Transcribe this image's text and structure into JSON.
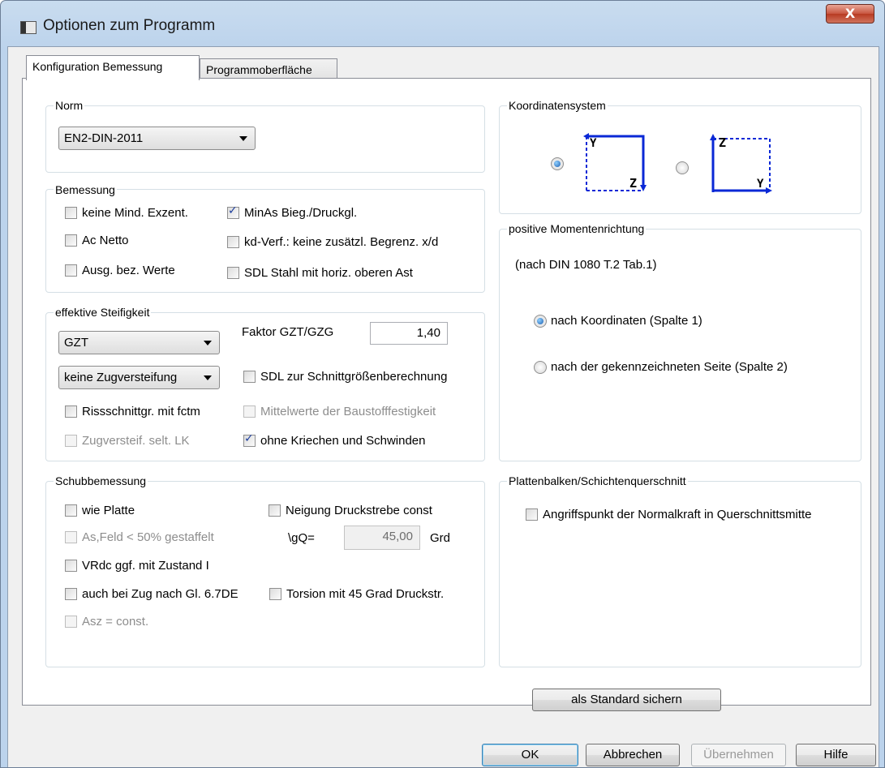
{
  "window": {
    "title": "Optionen zum Programm",
    "close_label": "X"
  },
  "tabs": [
    {
      "label": "Konfiguration Bemessung"
    },
    {
      "label": "Programmoberfläche"
    }
  ],
  "norm": {
    "title": "Norm",
    "selected": "EN2-DIN-2011"
  },
  "bemessung": {
    "title": "Bemessung",
    "items": [
      {
        "label": "keine Mind. Exzent.",
        "checked": false
      },
      {
        "label": "MinAs Bieg./Druckgl.",
        "checked": true
      },
      {
        "label": "Ac Netto",
        "checked": false
      },
      {
        "label": "kd-Verf.: keine zusätzl. Begrenz. x/d",
        "checked": false
      },
      {
        "label": "Ausg. bez. Werte",
        "checked": false
      },
      {
        "label": "SDL Stahl mit horiz. oberen Ast",
        "checked": false
      }
    ]
  },
  "steifigkeit": {
    "title": "effektive Steifigkeit",
    "select1": "GZT",
    "factor_label": "Faktor GZT/GZG",
    "factor_value": "1,40",
    "select2": "keine Zugversteifung",
    "items": [
      {
        "label": "SDL zur Schnittgrößenberechnung",
        "checked": false,
        "disabled": false
      },
      {
        "label": "Rissschnittgr. mit fctm",
        "checked": false,
        "disabled": false
      },
      {
        "label": "Mittelwerte der Baustofffestigkeit",
        "checked": false,
        "disabled": true
      },
      {
        "label": "Zugversteif. selt. LK",
        "checked": false,
        "disabled": true
      },
      {
        "label": "ohne Kriechen und Schwinden",
        "checked": true,
        "disabled": false
      }
    ]
  },
  "schub": {
    "title": "Schubbemessung",
    "items": [
      {
        "label": "wie Platte",
        "checked": false,
        "disabled": false
      },
      {
        "label": "Neigung Druckstrebe const",
        "checked": false,
        "disabled": false
      },
      {
        "label": "As,Feld < 50% gestaffelt",
        "checked": false,
        "disabled": true
      },
      {
        "label": "VRdc ggf. mit Zustand I",
        "checked": false,
        "disabled": false
      },
      {
        "label": "auch bei Zug nach Gl. 6.7DE",
        "checked": false,
        "disabled": false
      },
      {
        "label": "Torsion mit 45 Grad Druckstr.",
        "checked": false,
        "disabled": false
      },
      {
        "label": "Asz = const.",
        "checked": false,
        "disabled": true
      }
    ],
    "angle_label": "\\gQ=",
    "angle_value": "45,00",
    "angle_unit": "Grd"
  },
  "koordinaten": {
    "title": "Koordinatensystem",
    "axis_y": "Y",
    "axis_z": "Z",
    "selected_option": 1
  },
  "moment": {
    "title": "positive Momentenrichtung",
    "note": "(nach DIN 1080 T.2 Tab.1)",
    "options": [
      {
        "label": "nach Koordinaten (Spalte 1)",
        "checked": true
      },
      {
        "label": "nach der gekennzeichneten Seite (Spalte 2)",
        "checked": false
      }
    ]
  },
  "platten": {
    "title": "Plattenbalken/Schichtenquerschnitt",
    "items": [
      {
        "label": "Angriffspunkt der Normalkraft in Querschnittsmitte",
        "checked": false
      }
    ]
  },
  "buttons": {
    "standard": "als Standard sichern",
    "ok": "OK",
    "cancel": "Abbrechen",
    "apply": "Übernehmen",
    "help": "Hilfe"
  },
  "colors": {
    "axis": "#0a28d6",
    "accent": "#3c7fb1"
  }
}
